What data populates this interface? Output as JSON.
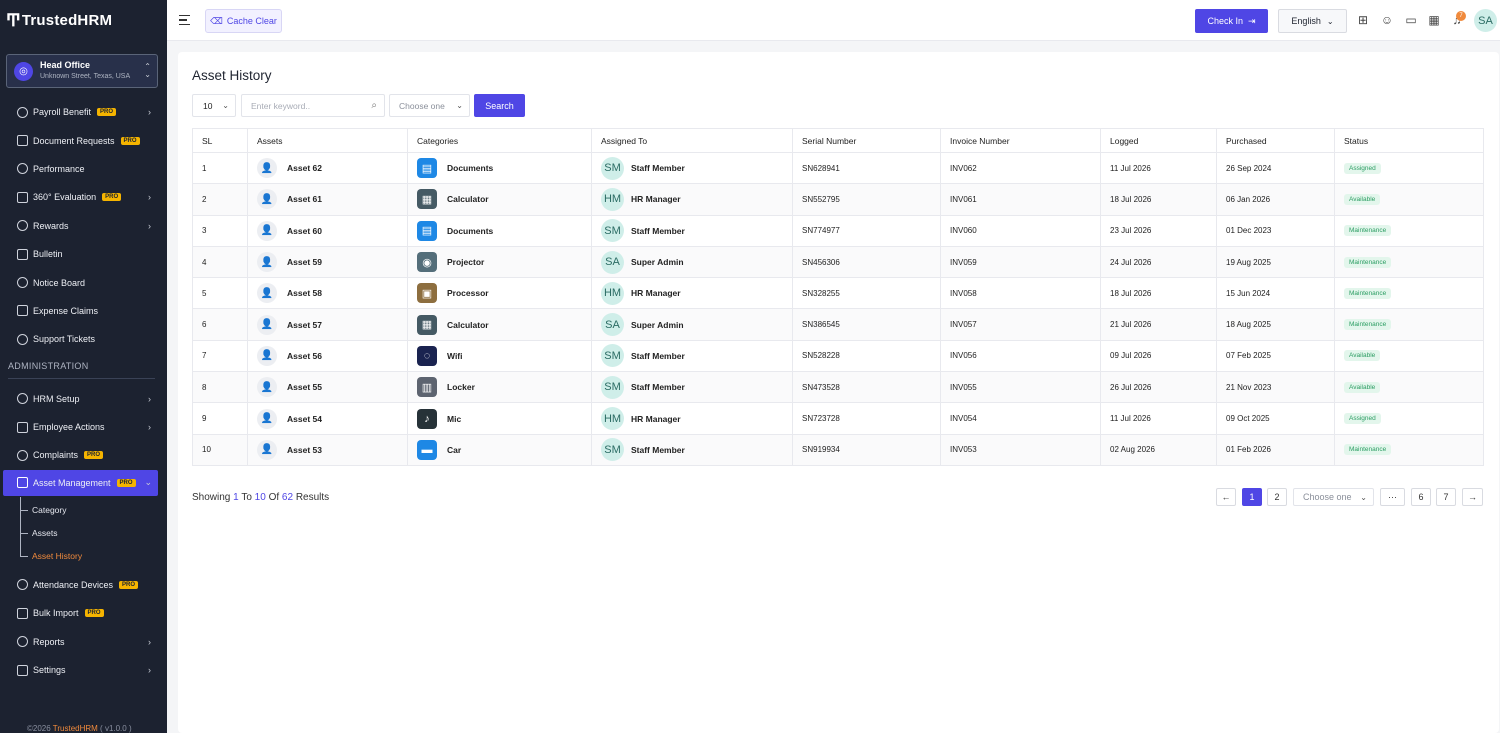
{
  "app": {
    "logo_text": "TrustedHRM"
  },
  "branch": {
    "name": "Head Office",
    "address": "Unknown Street, Texas, USA"
  },
  "sidebar": {
    "items_top": [
      {
        "label": "Payroll Benefit",
        "pro": "PRO",
        "arrow": true
      },
      {
        "label": "Document Requests",
        "pro": "PRO",
        "arrow": false
      },
      {
        "label": "Performance",
        "pro": "",
        "arrow": false
      },
      {
        "label": "360° Evaluation",
        "pro": "PRO",
        "arrow": true
      },
      {
        "label": "Rewards",
        "pro": "",
        "arrow": true
      },
      {
        "label": "Bulletin",
        "pro": "",
        "arrow": false
      },
      {
        "label": "Notice Board",
        "pro": "",
        "arrow": false
      },
      {
        "label": "Expense Claims",
        "pro": "",
        "arrow": false
      },
      {
        "label": "Support Tickets",
        "pro": "",
        "arrow": false
      }
    ],
    "section_title": "ADMINISTRATION",
    "items_admin": [
      {
        "label": "HRM Setup",
        "pro": "",
        "arrow": true
      },
      {
        "label": "Employee Actions",
        "pro": "",
        "arrow": true
      },
      {
        "label": "Complaints",
        "pro": "PRO",
        "arrow": false
      }
    ],
    "active_item": {
      "label": "Asset Management",
      "pro": "PRO"
    },
    "sub_items": [
      "Category",
      "Assets",
      "Asset History"
    ],
    "items_bottom": [
      {
        "label": "Attendance Devices",
        "pro": "PRO",
        "arrow": false
      },
      {
        "label": "Bulk Import",
        "pro": "PRO",
        "arrow": false
      },
      {
        "label": "Reports",
        "pro": "",
        "arrow": true
      },
      {
        "label": "Settings",
        "pro": "",
        "arrow": true
      }
    ],
    "footer_prefix": "©2026 ",
    "footer_brand": "TrustedHRM",
    "footer_suffix": " ( v1.0.0 )"
  },
  "topbar": {
    "cache_label": "Cache Clear",
    "checkin_label": "Check In",
    "language": "English",
    "notification_count": "7",
    "user_initials": "SA"
  },
  "page": {
    "title": "Asset History",
    "page_size": "10",
    "search_placeholder": "Enter keyword..",
    "filter_placeholder": "Choose one",
    "search_button": "Search"
  },
  "table": {
    "columns": [
      "SL",
      "Assets",
      "Categories",
      "Assigned To",
      "Serial Number",
      "Invoice Number",
      "Logged",
      "Purchased",
      "Status"
    ],
    "rows": [
      {
        "sl": "1",
        "asset": "Asset 62",
        "category": "Documents",
        "cat_icon": "document-icon",
        "cat_color": "#1e88e5",
        "initials": "SM",
        "assigned": "Staff Member",
        "serial": "SN628941",
        "invoice": "INV062",
        "logged": "11 Jul 2026",
        "purchased": "26 Sep 2024",
        "status": "Assigned"
      },
      {
        "sl": "2",
        "asset": "Asset 61",
        "category": "Calculator",
        "cat_icon": "calculator-icon",
        "cat_color": "#455a64",
        "initials": "HM",
        "assigned": "HR Manager",
        "serial": "SN552795",
        "invoice": "INV061",
        "logged": "18 Jul 2026",
        "purchased": "06 Jan 2026",
        "status": "Available"
      },
      {
        "sl": "3",
        "asset": "Asset 60",
        "category": "Documents",
        "cat_icon": "document-icon",
        "cat_color": "#1e88e5",
        "initials": "SM",
        "assigned": "Staff Member",
        "serial": "SN774977",
        "invoice": "INV060",
        "logged": "23 Jul 2026",
        "purchased": "01 Dec 2023",
        "status": "Maintenance"
      },
      {
        "sl": "4",
        "asset": "Asset 59",
        "category": "Projector",
        "cat_icon": "projector-icon",
        "cat_color": "#546e7a",
        "initials": "SA",
        "assigned": "Super Admin",
        "serial": "SN456306",
        "invoice": "INV059",
        "logged": "24 Jul 2026",
        "purchased": "19 Aug 2025",
        "status": "Maintenance"
      },
      {
        "sl": "5",
        "asset": "Asset 58",
        "category": "Processor",
        "cat_icon": "processor-icon",
        "cat_color": "#8d6e3f",
        "initials": "HM",
        "assigned": "HR Manager",
        "serial": "SN328255",
        "invoice": "INV058",
        "logged": "18 Jul 2026",
        "purchased": "15 Jun 2024",
        "status": "Maintenance"
      },
      {
        "sl": "6",
        "asset": "Asset 57",
        "category": "Calculator",
        "cat_icon": "calculator-icon",
        "cat_color": "#455a64",
        "initials": "SA",
        "assigned": "Super Admin",
        "serial": "SN386545",
        "invoice": "INV057",
        "logged": "21 Jul 2026",
        "purchased": "18 Aug 2025",
        "status": "Maintenance"
      },
      {
        "sl": "7",
        "asset": "Asset 56",
        "category": "Wifi",
        "cat_icon": "wifi-icon",
        "cat_color": "#1a2350",
        "initials": "SM",
        "assigned": "Staff Member",
        "serial": "SN528228",
        "invoice": "INV056",
        "logged": "09 Jul 2026",
        "purchased": "07 Feb 2025",
        "status": "Available"
      },
      {
        "sl": "8",
        "asset": "Asset 55",
        "category": "Locker",
        "cat_icon": "locker-icon",
        "cat_color": "#5d6470",
        "initials": "SM",
        "assigned": "Staff Member",
        "serial": "SN473528",
        "invoice": "INV055",
        "logged": "26 Jul 2026",
        "purchased": "21 Nov 2023",
        "status": "Available"
      },
      {
        "sl": "9",
        "asset": "Asset 54",
        "category": "Mic",
        "cat_icon": "microphone-icon",
        "cat_color": "#263238",
        "initials": "HM",
        "assigned": "HR Manager",
        "serial": "SN723728",
        "invoice": "INV054",
        "logged": "11 Jul 2026",
        "purchased": "09 Oct 2025",
        "status": "Assigned"
      },
      {
        "sl": "10",
        "asset": "Asset 53",
        "category": "Car",
        "cat_icon": "car-icon",
        "cat_color": "#1e88e5",
        "initials": "SM",
        "assigned": "Staff Member",
        "serial": "SN919934",
        "invoice": "INV053",
        "logged": "02 Aug 2026",
        "purchased": "01 Feb 2026",
        "status": "Maintenance"
      }
    ]
  },
  "footer": {
    "showing_word": "Showing",
    "from": "1",
    "to_word": "To",
    "to": "10",
    "of_word": "Of",
    "total": "62",
    "results_word": "Results"
  },
  "pagination": {
    "prev": "←",
    "pages": [
      "1",
      "2"
    ],
    "select_placeholder": "Choose one",
    "ellipsis": "···",
    "last_pages": [
      "6",
      "7"
    ],
    "next": "→",
    "current": "1"
  }
}
